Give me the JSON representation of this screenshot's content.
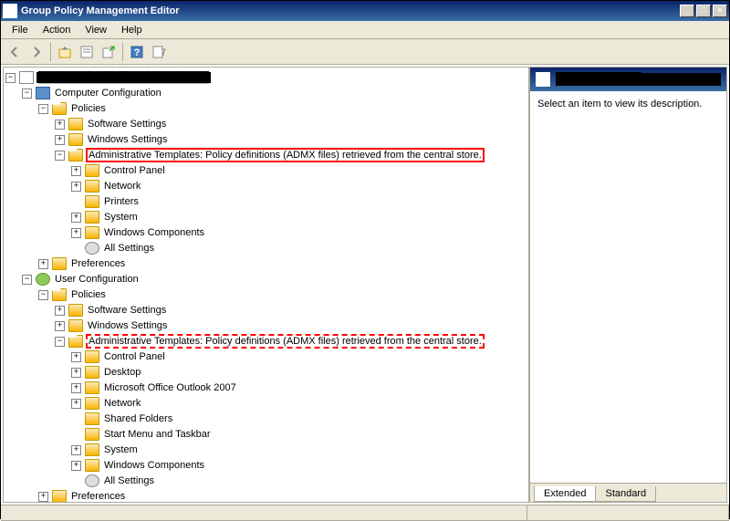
{
  "window": {
    "title": "Group Policy Management Editor"
  },
  "menu": {
    "file": "File",
    "action": "Action",
    "view": "View",
    "help": "Help"
  },
  "tree": {
    "root": "████████████████████████",
    "comp_config": "Computer Configuration",
    "policies": "Policies",
    "software_settings": "Software Settings",
    "windows_settings": "Windows Settings",
    "admin_templates": "Administrative Templates: Policy definitions (ADMX files) retrieved from the central store.",
    "control_panel": "Control Panel",
    "network": "Network",
    "printers": "Printers",
    "system": "System",
    "windows_components": "Windows Components",
    "all_settings": "All Settings",
    "preferences": "Preferences",
    "user_config": "User Configuration",
    "desktop": "Desktop",
    "outlook": "Microsoft Office Outlook 2007",
    "shared_folders": "Shared Folders",
    "start_menu": "Start Menu and Taskbar"
  },
  "desc": {
    "header": "████████████",
    "body": "Select an item to view its description."
  },
  "tabs": {
    "extended": "Extended",
    "standard": "Standard"
  }
}
